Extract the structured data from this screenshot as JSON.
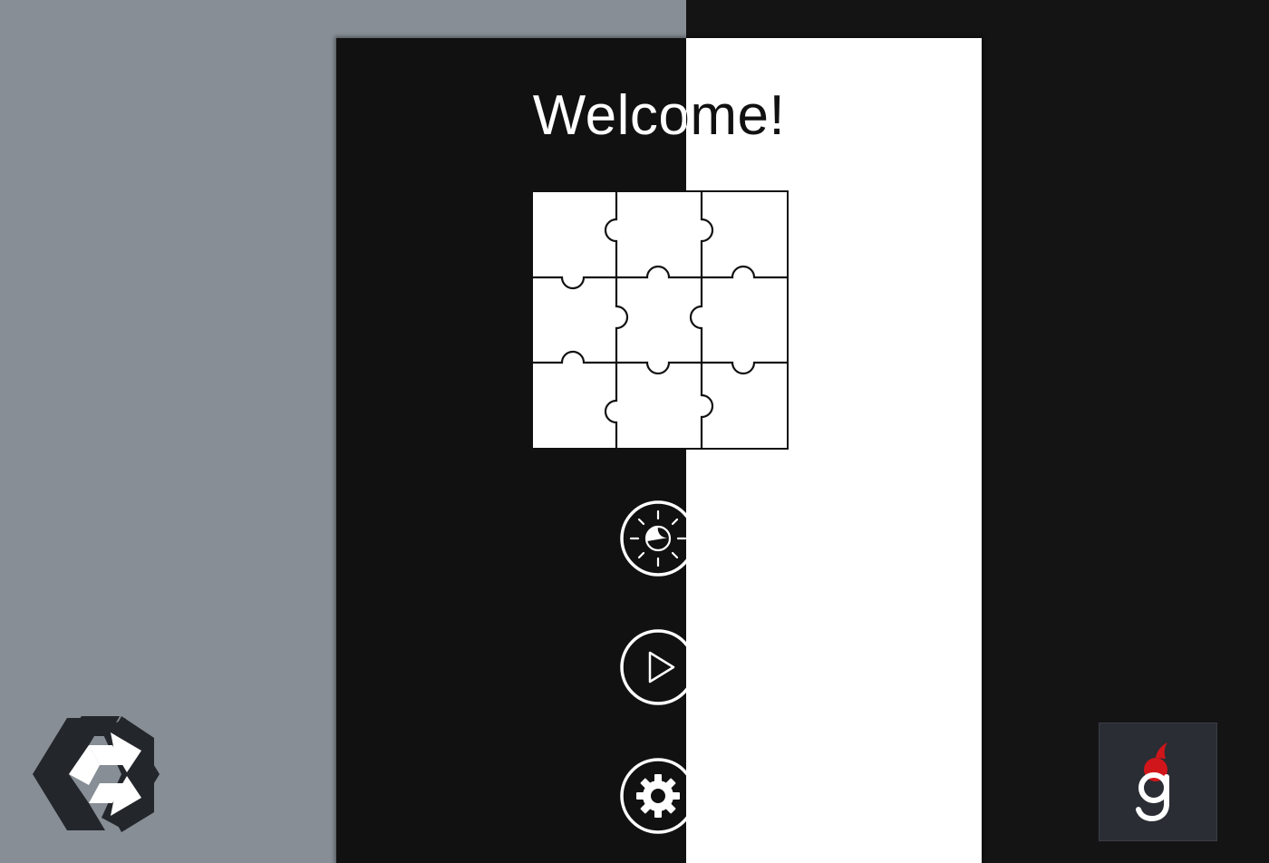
{
  "screen": {
    "title": "Welcome!"
  },
  "buttons": [
    {
      "name": "theme-toggle-button",
      "icon": "sun-moon-icon"
    },
    {
      "name": "play-button",
      "icon": "play-icon"
    },
    {
      "name": "settings-button",
      "icon": "gear-icon"
    }
  ],
  "puzzle": {
    "grid": "3x3",
    "icon": "jigsaw-puzzle-icon"
  },
  "branding": {
    "left_logo": "unity-logo",
    "right_logo": "g-logo",
    "right_logo_accent": "#d0161b"
  },
  "colors": {
    "left_background": "#878e95",
    "right_background": "#141414",
    "dark_panel": "#111111",
    "light_panel": "#ffffff"
  }
}
